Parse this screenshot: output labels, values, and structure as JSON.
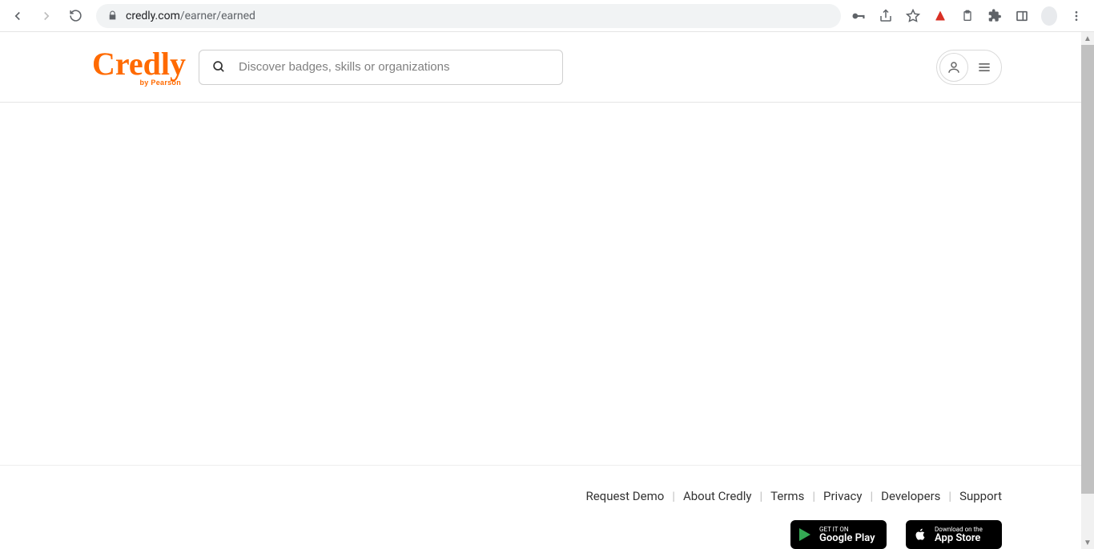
{
  "browser": {
    "url_domain": "credly.com",
    "url_path": "/earner/earned"
  },
  "header": {
    "logo_text": "Credly",
    "logo_sub": "by Pearson",
    "search_placeholder": "Discover badges, skills or organizations"
  },
  "footer": {
    "links": [
      "Request Demo",
      "About Credly",
      "Terms",
      "Privacy",
      "Developers",
      "Support"
    ],
    "google_play": {
      "small": "GET IT ON",
      "big": "Google Play"
    },
    "app_store": {
      "small": "Download on the",
      "big": "App Store"
    }
  }
}
